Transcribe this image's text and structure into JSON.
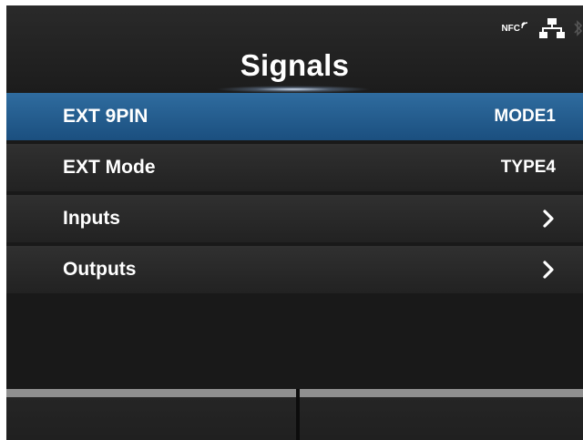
{
  "header": {
    "title": "Signals",
    "status": {
      "nfc_label": "NFC",
      "icons": [
        "nfc-icon",
        "network-icon",
        "bluetooth-icon"
      ]
    }
  },
  "menu": {
    "items": [
      {
        "label": "EXT 9PIN",
        "value": "MODE1",
        "selected": true
      },
      {
        "label": "EXT Mode",
        "value": "TYPE4",
        "selected": false
      },
      {
        "label": "Inputs",
        "icon": "chevron-right-icon",
        "selected": false
      },
      {
        "label": "Outputs",
        "icon": "chevron-right-icon",
        "selected": false
      }
    ]
  },
  "softkeys": {
    "left": "",
    "right": ""
  },
  "colors": {
    "selected_row": "#2a6598",
    "row": "#2b2b2b",
    "background": "#191919",
    "text": "#ffffff"
  }
}
